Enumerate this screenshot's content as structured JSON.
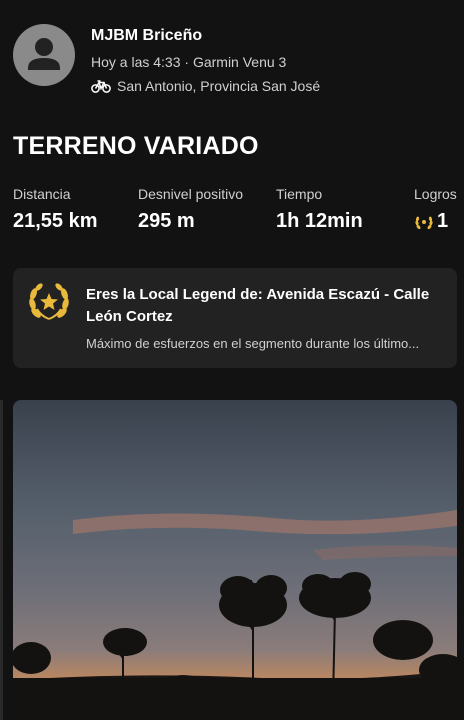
{
  "activity": {
    "user_name": "MJBM Briceño",
    "meta": "Hoy a las 4:33 · Garmin Venu 3",
    "location": "San Antonio, Provincia San José",
    "title": "TERRENO VARIADO"
  },
  "stats": [
    {
      "label": "Distancia",
      "value": "21,55 km"
    },
    {
      "label": "Desnivel positivo",
      "value": "295 m"
    },
    {
      "label": "Tiempo",
      "value": "1h 12min"
    },
    {
      "label": "Logros",
      "value": "1"
    }
  ],
  "achievement_card": {
    "title": "Eres la Local Legend de: Avenida Escazú  - Calle León Cortez",
    "description": "Máximo de esfuerzos en el segmento durante los último..."
  },
  "icons": {
    "avatar": "person-icon",
    "activity_type": "bike-icon",
    "achievement": "laurel-icon"
  },
  "colors": {
    "background": "#121212",
    "card": "#222222",
    "laurel": "#e8b93a"
  }
}
